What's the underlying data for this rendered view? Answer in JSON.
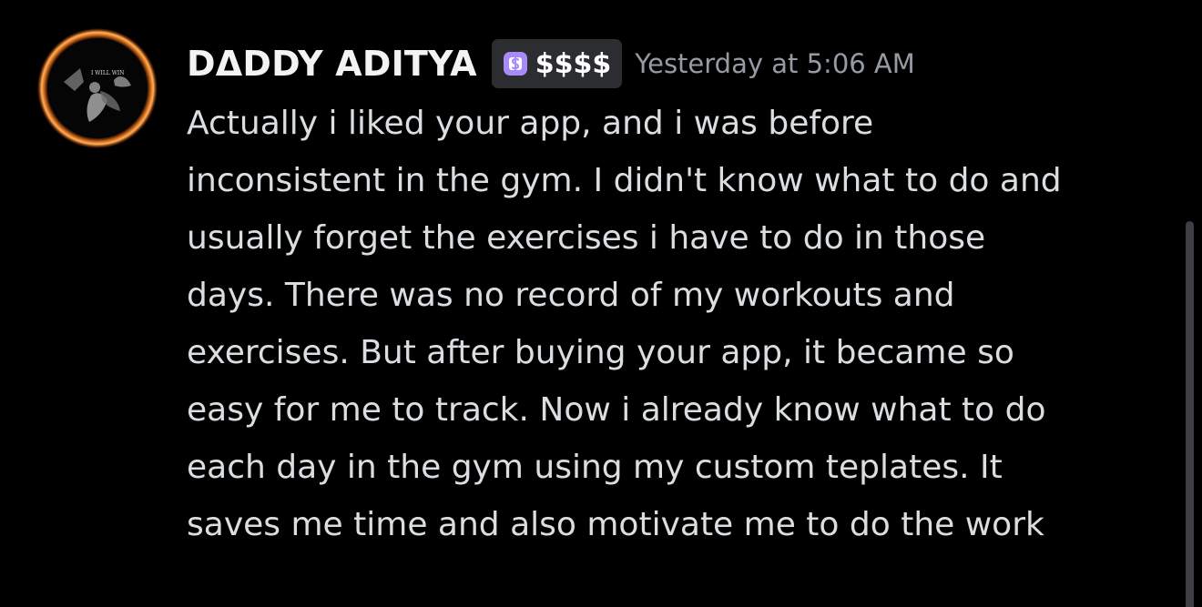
{
  "message": {
    "username": "DΔDDY ADITYA",
    "avatar_text": "I WILL WIN",
    "tag": {
      "icon": "dollar-badge-icon",
      "label": "$$$$",
      "icon_color": "#a78bfa"
    },
    "timestamp": "Yesterday at 5:06 AM",
    "lines": [
      "Actually i liked your app, and i was before",
      "inconsistent in the gym. I didn't know what to do and",
      "usually forget the exercises i have to do in those",
      "days. There was no record of my workouts and",
      "exercises. But after buying your app, it became so",
      "easy for me to track. Now i already know what to do",
      "each day in the gym using my custom teplates. It",
      "saves me time and also motivate me to do the work"
    ]
  },
  "colors": {
    "background": "#000000",
    "username": "#f2f3f5",
    "timestamp": "#949ba4",
    "text": "#dbdee1",
    "tag_background": "#2b2d31"
  }
}
